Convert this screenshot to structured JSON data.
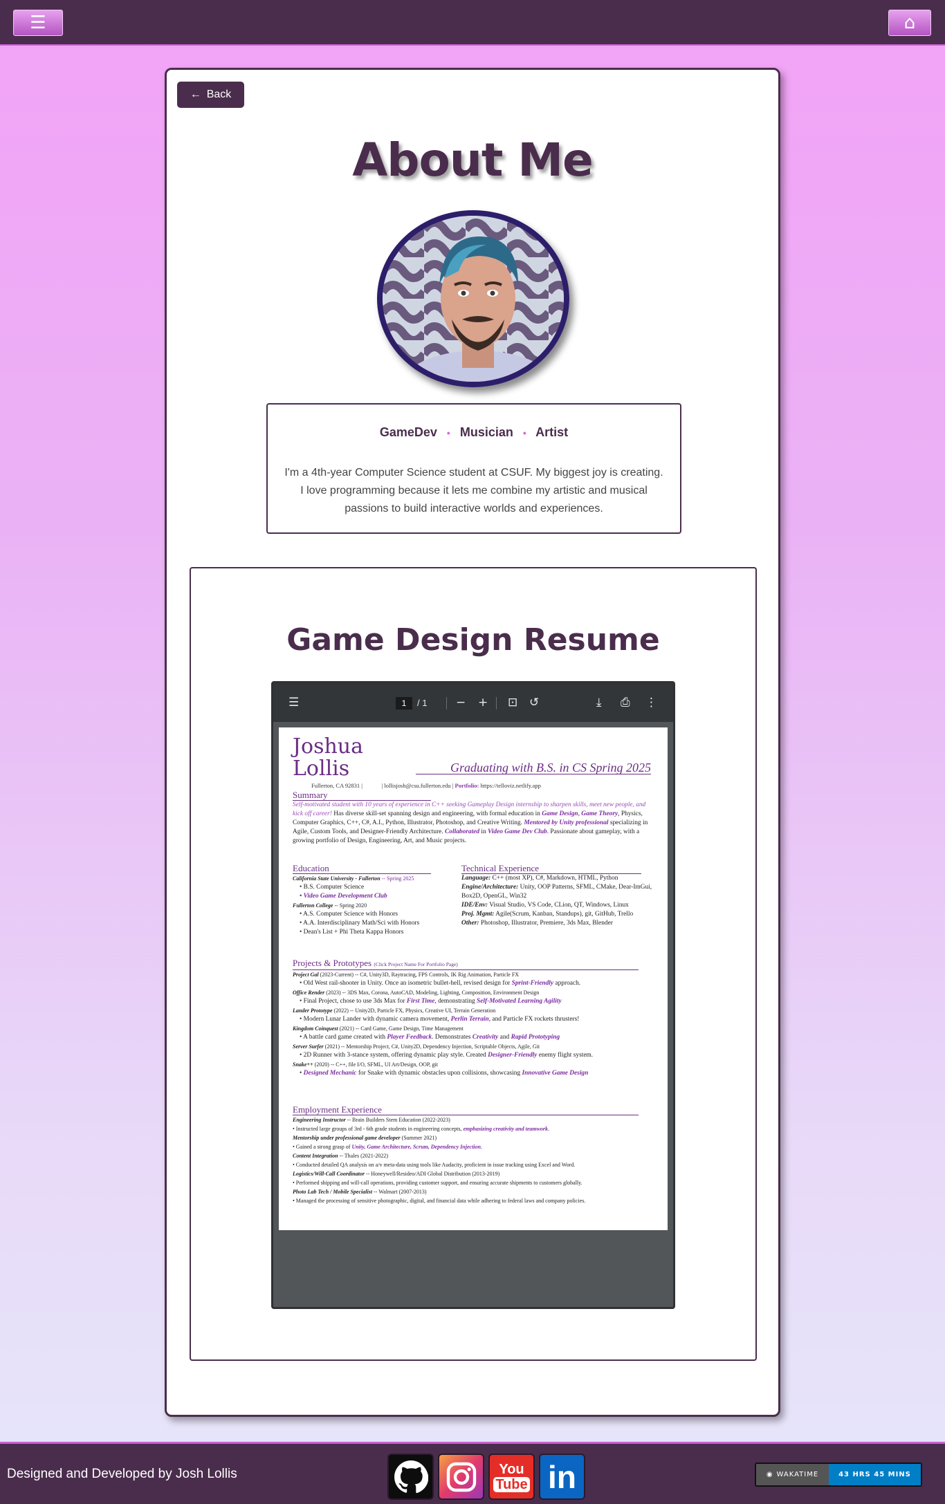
{
  "header": {
    "menu_icon": "hamburger-icon",
    "home_icon": "home-icon"
  },
  "card": {
    "back_label": "Back",
    "back_arrow": "←",
    "title": "About Me",
    "roles": [
      "GameDev",
      "Musician",
      "Artist"
    ],
    "bio": "I'm a 4th-year Computer Science student at CSUF. My biggest joy is creating. I love programming because it lets me combine my artistic and musical passions to build interactive worlds and experiences."
  },
  "resume": {
    "title": "Game Design Resume",
    "viewer": {
      "current_page": "1",
      "total_pages": "/ 1"
    },
    "doc": {
      "name_first": "Joshua",
      "name_last": "Lollis",
      "graduating": "Graduating with B.S. in CS  Spring 2025",
      "location": "Fullerton, CA 92831",
      "email": "lollisjosh@csu.fullerton.edu",
      "portfolio_label": "Portfolio:",
      "portfolio_url": "https://telloviz.netlify.app",
      "summary_heading": "Summary",
      "summary_lead": "Self-motivated student with 10 years of experience in C++ seeking Gameplay Design internship to sharpen skills, meet new people, and kick off career!",
      "summary_1": " Has diverse skill-set spanning design and engineering, with formal education in ",
      "summary_hl1": "Game Design",
      "summary_hl2": "Game Theory",
      "summary_2": ", Physics, Computer Graphics, C++, C#, A.I., Python, Illustrator, Photoshop, and Creative Writing. ",
      "summary_hl3": "Mentored by Unity professional",
      "summary_3": " specializing in Agile, Custom Tools, and Designer-Friendly Architecture. ",
      "summary_hl4": "Collaborated",
      "summary_4": " in ",
      "summary_hl5": "Video Game Dev Club",
      "summary_5": ". Passionate about gameplay, with a growing portfolio of Design, Engineering, Art, and Music projects.",
      "education_heading": "Education",
      "edu": [
        {
          "school": "California State University - Fullerton",
          "date": " -- Spring 2025"
        },
        {
          "item": "• B.S. Computer Science"
        },
        {
          "item_hl": "• Video Game Development Club"
        },
        {
          "school": "Fullerton College",
          "date": " -- Spring 2020"
        },
        {
          "item": "• A.S. Computer Science with Honors"
        },
        {
          "item": "• A.A. Interdisciplinary Math/Sci with Honors"
        },
        {
          "item": "• Dean's List + Phi Theta Kappa Honors"
        }
      ],
      "tech_heading": "Technical Experience",
      "tech": [
        {
          "k": "Language:",
          "v": " C++ (most XP), C#, Markdown, HTML, Python"
        },
        {
          "k": "Engine/Architecture:",
          "v": " Unity, OOP Patterns, SFML, CMake, Dear-ImGui, Box2D, OpenGL, Win32"
        },
        {
          "k": "IDE/Env:",
          "v": " Visual Studio, VS Code, CLion, QT, Windows, Linux"
        },
        {
          "k": "Proj. Mgmt:",
          "v": " Agile(Scrum, Kanban, Standups), git, GitHub, Trello"
        },
        {
          "k": "Other:",
          "v": " Photoshop, Illustrator, Premiere, 3ds Max, Blender"
        }
      ],
      "proj_heading": "Projects & Prototypes",
      "proj_note": "(Click Project Name For Portfolio Page)",
      "projects": [
        {
          "t": "Project Gal",
          "d": " (2023-Current) -- C#, Unity3D, Raytracing, FPS Controls, IK Rig Animation, Particle FX"
        },
        {
          "b": "• Old West rail-shooter in Unity. Once an isometric bullet-hell, revised design for ",
          "h": "Sprint-Friendly",
          "e": " approach."
        },
        {
          "t": "Office Render",
          "d": " (2023) -- 3DS Max, Corona, AutoCAD, Modeling, Lighting, Composition, Environment Design"
        },
        {
          "b": "• Final Project, chose to use 3ds Max for ",
          "h": "First Time",
          "e": ", demonstrating ",
          "h2": "Self-Motivated Learning Agility"
        },
        {
          "t": "Lander Prototype",
          "d": " (2022) -- Unity2D, Particle FX, Physics, Creative UI, Terrain Generation"
        },
        {
          "b": "• Modern Lunar Lander with dynamic camera movement, ",
          "h": "Perlin Terrain",
          "e": ", and Particle FX rockets thrusters!"
        },
        {
          "t": "Kingdom Coinquest",
          "d": " (2021) -- Card Game, Game Design, Time Management"
        },
        {
          "b": "• A battle card game created with ",
          "h": "Player Feedback",
          "e": ". Demonstrates ",
          "h2": "Creativity",
          "e2": " and ",
          "h3": "Rapid Prototyping"
        },
        {
          "t": "Server Surfer",
          "d": " (2021) -- Mentorship Project, C#, Unity2D, Dependency Injection, Scriptable Objects, Agile, Git"
        },
        {
          "b": "• 2D Runner with 3-stance system, offering dynamic play style. Created ",
          "h": "Designer-Friendly",
          "e": " enemy flight system."
        },
        {
          "t": "Snake++",
          "d": " (2020) -- C++, file I/O, SFML, UI Art/Design, OOP, git"
        },
        {
          "b": "• ",
          "h": "Designed Mechanic",
          "e": " for Snake with dynamic obstacles upon collisions, showcasing ",
          "h2": "Innovative Game Design"
        }
      ],
      "emp_heading": "Employment Experience",
      "employment": [
        {
          "t": "Engineering Instructor",
          "d": " -- Brain Builders Stem Education (2022-2023)"
        },
        {
          "b": "• Instructed large groups of 3rd - 6th grade students in engineering concepts, ",
          "h": "emphasizing creativity and teamwork",
          "e": "."
        },
        {
          "t": "Mentorship under professional game developer",
          "d": " (Summer 2021)"
        },
        {
          "b": "• Gained a strong grasp of ",
          "h": "Unity, Game Architecture, Scrum, Dependency Injection",
          "e": "."
        },
        {
          "t": "Content Integration",
          "d": " -- Thales (2021-2022)"
        },
        {
          "b": "• Conducted detailed QA analysis on a/v meta-data using tools like Audacity, proficient in issue tracking using Excel and Word."
        },
        {
          "t": "Logistics/Will-Call Coordinator",
          "d": " -- Honeywell/Resideo/ADI Global Distribution (2013-2019)"
        },
        {
          "b": "• Performed shipping and will-call operations, providing customer support, and ensuring accurate shipments to customers globally."
        },
        {
          "t": "Photo Lab Tech / Mobile Specialist",
          "d": " -- Walmart (2007-2013)"
        },
        {
          "b": "• Managed the processing of sensitive photographic, digital, and financial data while adhering to federal laws and company policies."
        }
      ]
    }
  },
  "footer": {
    "credit": "Designed and Developed by Josh Lollis",
    "social": [
      "github-icon",
      "instagram-icon",
      "youtube-icon",
      "linkedin-icon"
    ],
    "youtube_you": "You",
    "youtube_tube": "Tube",
    "linkedin_text": "in",
    "wakatime_label": "WAKATIME",
    "wakatime_value": "43 HRS 45 MINS"
  },
  "colors": {
    "brand": "#4a2d4c",
    "accent": "#d36ad8",
    "resume_purple": "#6b2d85",
    "wakatime_blue": "#007ec6"
  }
}
